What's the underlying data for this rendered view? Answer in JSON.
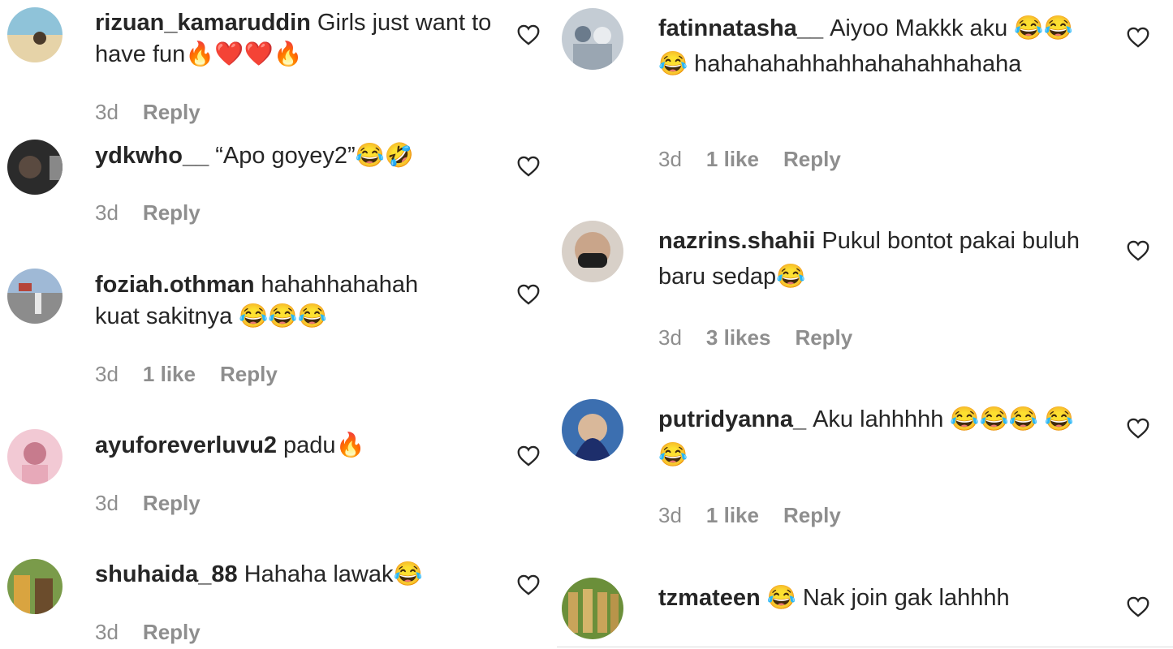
{
  "comments": [
    {
      "username": "rizuan_kamaruddin",
      "text": "Girls just want to have fun🔥❤️❤️🔥",
      "time": "3d",
      "likes": "",
      "reply": "Reply",
      "avatar_colors": [
        "#8fc3d9",
        "#e6d3a8"
      ]
    },
    {
      "username": "ydkwho__",
      "text": "“Apo goyey2”😂🤣",
      "time": "3d",
      "likes": "",
      "reply": "Reply",
      "avatar_colors": [
        "#2b2b2b",
        "#5a4a40"
      ]
    },
    {
      "username": "foziah.othman",
      "text": "hahahhahahah kuat sakitnya 😂😂😂",
      "time": "3d",
      "likes": "1 like",
      "reply": "Reply",
      "avatar_colors": [
        "#9fb9d6",
        "#8c8c8c"
      ]
    },
    {
      "username": "ayuforeverluvu2",
      "text": "padu🔥",
      "time": "3d",
      "likes": "",
      "reply": "Reply",
      "avatar_colors": [
        "#f2c9d4",
        "#c77b8d"
      ]
    },
    {
      "username": "shuhaida_88",
      "text": "Hahaha lawak😂",
      "time": "3d",
      "likes": "",
      "reply": "Reply",
      "avatar_colors": [
        "#d9a440",
        "#6b4c2c"
      ]
    },
    {
      "username": "fatinnatasha__",
      "text": "Aiyoo Makkk aku 😂😂😂 hahahahahhahhahahahhahaha",
      "time": "3d",
      "likes": "1 like",
      "reply": "Reply",
      "avatar_colors": [
        "#c4ccd4",
        "#6b7b8c"
      ]
    },
    {
      "username": "nazrins.shahii",
      "text": "Pukul bontot pakai buluh baru sedap😂",
      "time": "3d",
      "likes": "3 likes",
      "reply": "Reply",
      "avatar_colors": [
        "#c9a58a",
        "#1e1e1e"
      ]
    },
    {
      "username": "putridyanna_",
      "text": "Aku lahhhhh 😂😂😂 😂😂",
      "time": "3d",
      "likes": "1 like",
      "reply": "Reply",
      "avatar_colors": [
        "#1d2e6b",
        "#3c6fb0"
      ]
    },
    {
      "username": "tzmateen",
      "text": "😂 Nak join gak lahhhh",
      "time": "",
      "likes": "",
      "reply": "",
      "avatar_colors": [
        "#6b8f3a",
        "#c9a45a"
      ]
    }
  ]
}
